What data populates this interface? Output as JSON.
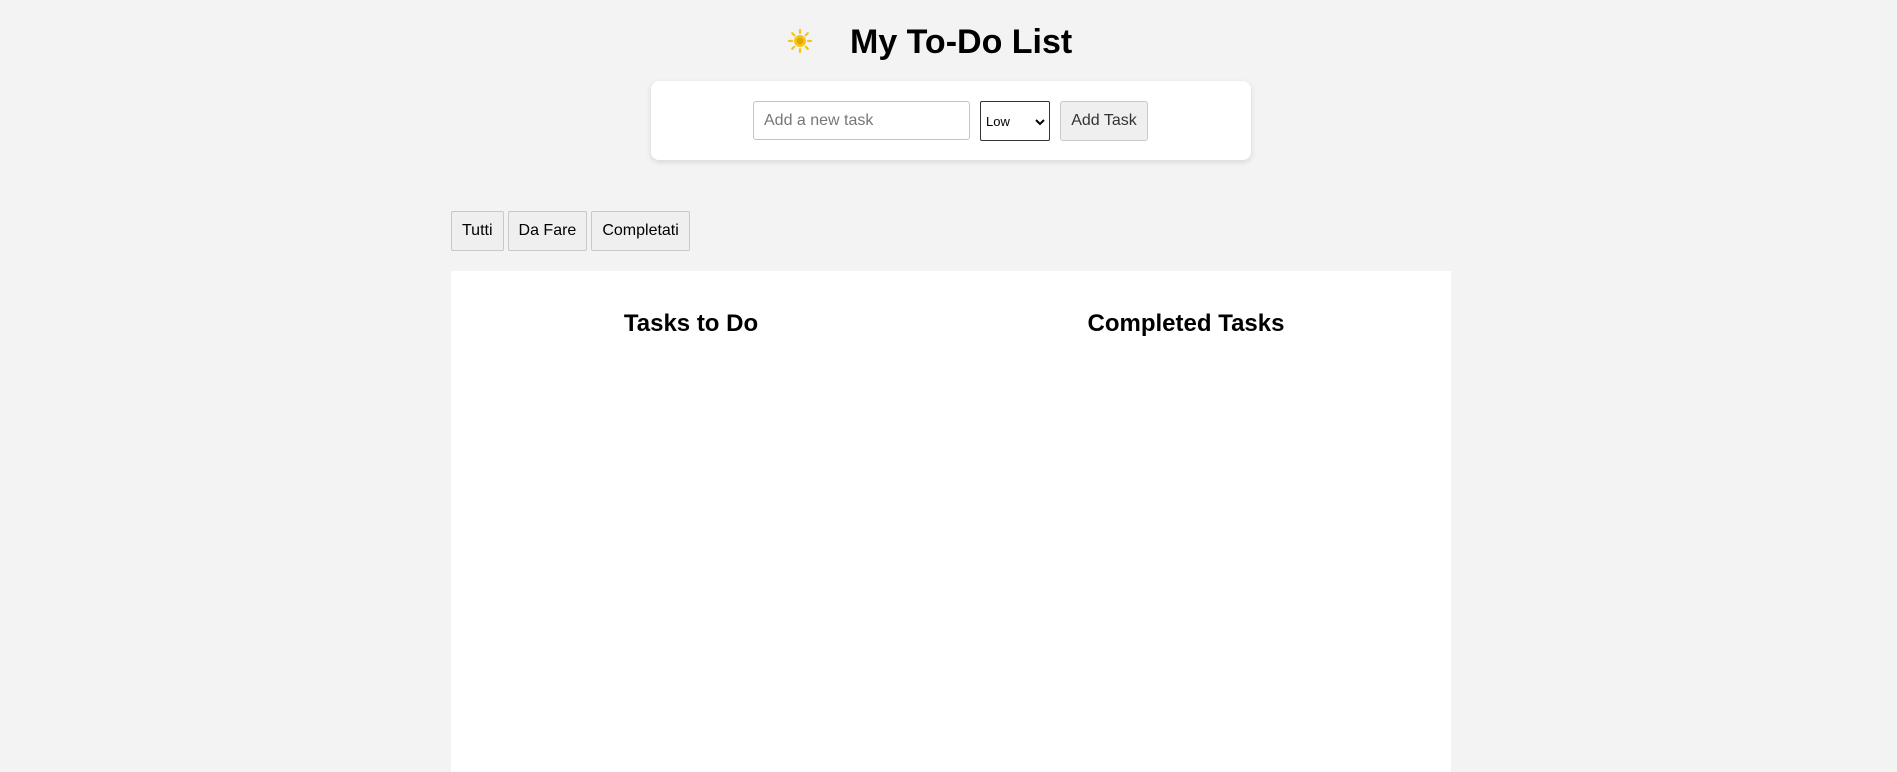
{
  "header": {
    "theme_icon": "sun-icon",
    "title": "My To-Do List"
  },
  "add_task": {
    "input_placeholder": "Add a new task",
    "input_value": "",
    "priority_selected": "Low",
    "add_button_label": "Add Task"
  },
  "filters": [
    {
      "label": "Tutti"
    },
    {
      "label": "Da Fare"
    },
    {
      "label": "Completati"
    }
  ],
  "columns": {
    "todo_title": "Tasks to Do",
    "completed_title": "Completed Tasks"
  },
  "colors": {
    "background": "#f3f3f3",
    "card": "#ffffff",
    "sun": "#f5c518"
  }
}
